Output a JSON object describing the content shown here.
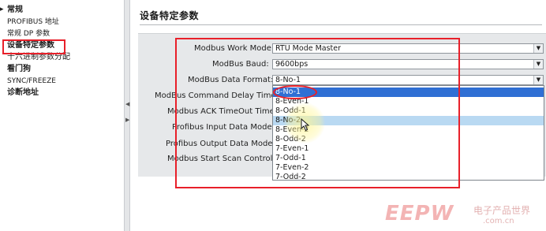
{
  "nav": {
    "items": [
      {
        "label": "常规",
        "bold": true
      },
      {
        "label": "PROFIBUS 地址",
        "bold": false
      },
      {
        "label": "常规 DP 参数",
        "bold": false
      },
      {
        "label": "设备特定参数",
        "bold": true
      },
      {
        "label": "十六进制参数分配",
        "bold": false
      },
      {
        "label": "看门狗",
        "bold": true
      },
      {
        "label": "SYNC/FREEZE",
        "bold": false
      },
      {
        "label": "诊断地址",
        "bold": true
      }
    ],
    "selected_index": 3
  },
  "section": {
    "title": "设备特定参数"
  },
  "params": [
    {
      "label": "Modbus Work Mode:",
      "value": "RTU Mode Master"
    },
    {
      "label": "ModBus Baud:",
      "value": "9600bps"
    },
    {
      "label": "ModBus Data Format:",
      "value": "8-No-1"
    },
    {
      "label": "ModBus Command Delay Time:",
      "value": ""
    },
    {
      "label": "Modbus ACK TimeOut Time:",
      "value": ""
    },
    {
      "label": "Profibus Input Data Mode:",
      "value": ""
    },
    {
      "label": "Profibus Output Data Mode:",
      "value": ""
    },
    {
      "label": "Modbus Start Scan Control:",
      "value": ""
    }
  ],
  "dropdown": {
    "options": [
      "8-No-1",
      "8-Even-1",
      "8-Odd-1",
      "8-No-2",
      "8-Even-2",
      "8-Odd-2",
      "7-Even-1",
      "7-Odd-1",
      "7-Even-2",
      "7-Odd-2"
    ],
    "selected": "8-No-1",
    "hovered": "8-No-2"
  },
  "watermark": {
    "logo": "EEPW",
    "cn": "电子产品世界",
    "url": ".com.cn"
  },
  "colors": {
    "annotation_red": "#e8202a",
    "selection_blue": "#2f6fd4",
    "hover_blue": "#b9d9f2",
    "panel_gray": "#e6e8ea"
  }
}
